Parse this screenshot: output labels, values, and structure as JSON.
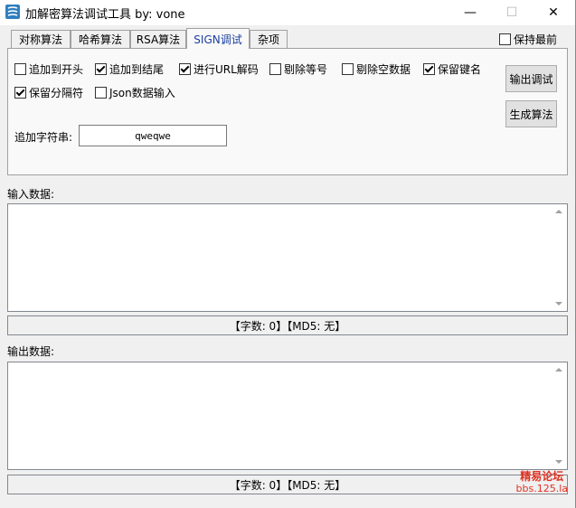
{
  "window": {
    "title": "加解密算法调试工具  by: vone",
    "minimize": "—",
    "maximize": "☐",
    "close": "✕"
  },
  "tabs": [
    {
      "label": "对称算法",
      "active": false
    },
    {
      "label": "哈希算法",
      "active": false
    },
    {
      "label": "RSA算法",
      "active": false
    },
    {
      "label": "SIGN调试",
      "active": true
    },
    {
      "label": "杂项",
      "active": false
    }
  ],
  "keep_on_top": {
    "label": "保持最前",
    "checked": false
  },
  "options": {
    "add_start": {
      "label": "追加到开头",
      "checked": false
    },
    "add_end": {
      "label": "追加到结尾",
      "checked": true
    },
    "url_decode": {
      "label": "进行URL解码",
      "checked": true
    },
    "remove_equals": {
      "label": "剔除等号",
      "checked": false
    },
    "remove_empty": {
      "label": "剔除空数据",
      "checked": false
    },
    "keep_key": {
      "label": "保留键名",
      "checked": true
    },
    "keep_sep": {
      "label": "保留分隔符",
      "checked": true
    },
    "json_input": {
      "label": "Json数据输入",
      "checked": false
    }
  },
  "buttons": {
    "output_debug": "输出调试",
    "generate": "生成算法"
  },
  "append_string": {
    "label": "追加字符串:",
    "value": "qweqwe"
  },
  "input_section": {
    "label": "输入数据:",
    "value": "",
    "status": "【字数: 0】【MD5: 无】"
  },
  "output_section": {
    "label": "输出数据:",
    "value": "",
    "status": "【字数: 0】【MD5: 无】"
  },
  "watermark": {
    "line1": "精易论坛",
    "line2": "bbs.125.la"
  }
}
